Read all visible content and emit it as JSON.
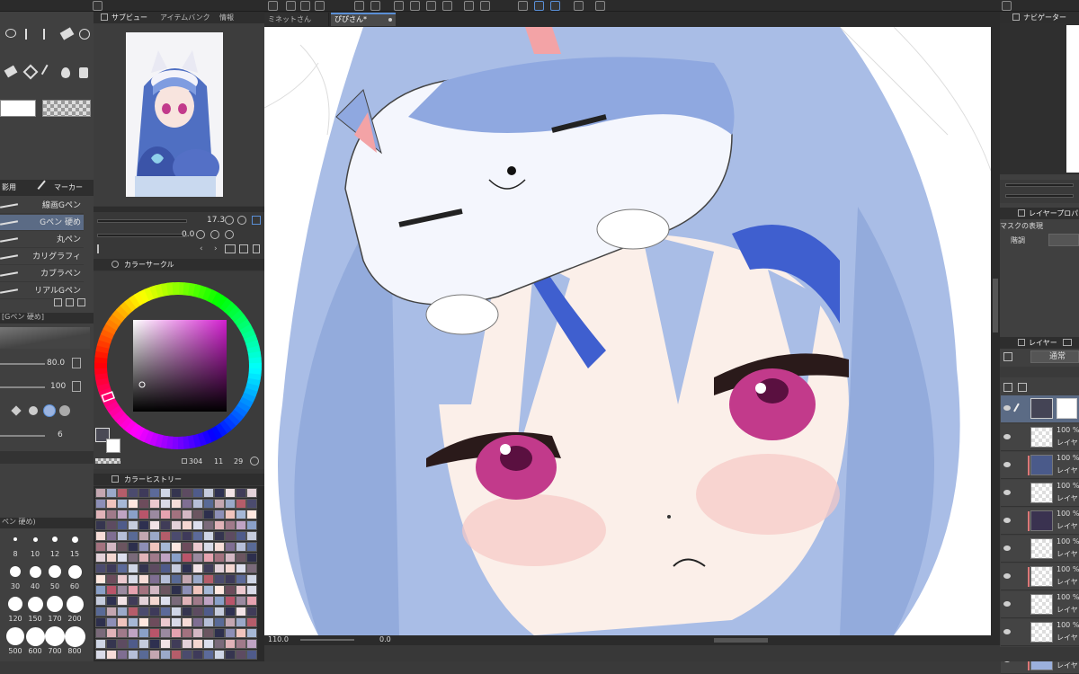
{
  "tabs": {
    "subview": "サブビュー",
    "item_bank": "アイテムバンク",
    "info": "情報",
    "doc1": "ミネットさん",
    "doc2": "ぴぴさん*",
    "navigator": "ナビゲーター",
    "color_circle": "カラーサークル",
    "color_history": "カラーヒストリー",
    "layer_property": "レイヤープロパティ",
    "layer": "レイヤー"
  },
  "tool": {
    "sub_tab_left": "影用",
    "sub_tab_right": "マーカー",
    "brushes": [
      "線画Gペン",
      "Gペン 硬め",
      "丸ペン",
      "カリグラフィ",
      "カブラペン",
      "リアルGペン"
    ],
    "tool_property_title": "[Gペン 硬め]",
    "brush_size": "80.0",
    "opacity": "100",
    "stabilization": "6",
    "brush_size_palette_title": "ペン 硬め)"
  },
  "brush_sizes": [
    "8",
    "10",
    "12",
    "15",
    "30",
    "40",
    "50",
    "60",
    "120",
    "150",
    "170",
    "200",
    "500",
    "600",
    "700",
    "800"
  ],
  "subview": {
    "zoom": "17.3",
    "rotate": "0.0"
  },
  "color": {
    "h": "304",
    "s": "11",
    "v": "29",
    "history_colors": [
      "#c4a7b1",
      "#6b5560",
      "#e3d2d9",
      "#9ba9c9",
      "#2d2f4d",
      "#f4d7d1",
      "#b55d6a",
      "#8d8fb7",
      "#dcdfee",
      "#4b4b6e",
      "#f0c4bd",
      "#7a6a7a",
      "#3e3a5a",
      "#a6b8d6",
      "#e0b3b8",
      "#5c6a9a",
      "#ffe8e0",
      "#a07a8a",
      "#cfd6e6",
      "#6d4c5c",
      "#bfa3c3",
      "#35354f",
      "#ecc9cf",
      "#8aa0c8",
      "#5d4b61",
      "#d9dbe8",
      "#b9556a",
      "#4f5b8a",
      "#f7ddd8",
      "#9b8aa0",
      "#c6ccdd",
      "#7f6e92",
      "#e6a3b0",
      "#2e3050",
      "#b6bfd8",
      "#a3727f",
      "#f2e3e6",
      "#596a96",
      "#d4b8c4",
      "#403c58"
    ]
  },
  "layers": {
    "mask_label": "マスクの表現",
    "tone_label": "階調",
    "blend_mode": "通常",
    "rows": [
      {
        "pct": "100 %",
        "name": "レイヤ"
      },
      {
        "pct": "100 %",
        "name": "レイヤ"
      },
      {
        "pct": "100 %",
        "name": "レイヤ"
      },
      {
        "pct": "100 %",
        "name": "レイヤ"
      },
      {
        "pct": "100 %",
        "name": "レイヤ"
      },
      {
        "pct": "100 %",
        "name": "レイヤ"
      },
      {
        "pct": "100 %",
        "name": "レイヤ"
      },
      {
        "pct": "100 %",
        "name": "レイヤ"
      },
      {
        "pct": "100 %",
        "name": "レイヤ"
      }
    ]
  },
  "status": {
    "zoom": "110.0",
    "angle": "0.0"
  },
  "colors": {
    "accent": "#5a8fd6",
    "panel": "#404040",
    "dark": "#2b2b2b",
    "canvas_bg": "#ffffff",
    "hair": "#a9bde6",
    "eye": "#c23a8b"
  }
}
